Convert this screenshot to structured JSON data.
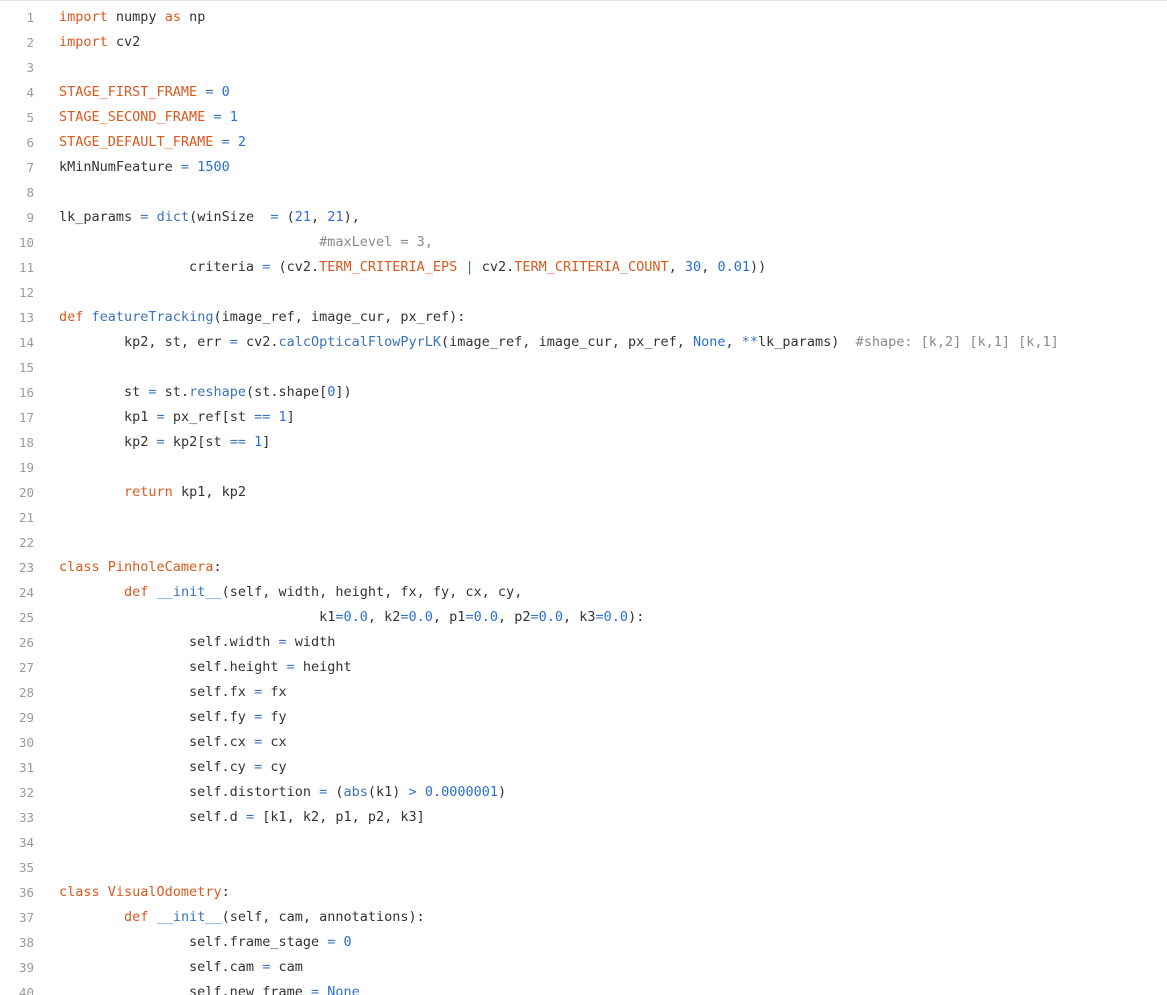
{
  "editor": {
    "language": "python",
    "colors": {
      "keyword": "#d9591f",
      "function": "#3b73bf",
      "number": "#2a6fd6",
      "comment": "#8a8a8a",
      "text": "#333333",
      "line_number": "#9a9a9a"
    },
    "lines": [
      {
        "n": "1",
        "tokens": [
          [
            "kw",
            "import"
          ],
          [
            "plain",
            " numpy "
          ],
          [
            "kw",
            "as"
          ],
          [
            "plain",
            " np"
          ]
        ]
      },
      {
        "n": "2",
        "tokens": [
          [
            "kw",
            "import"
          ],
          [
            "plain",
            " cv2"
          ]
        ]
      },
      {
        "n": "3",
        "tokens": []
      },
      {
        "n": "4",
        "tokens": [
          [
            "const",
            "STAGE_FIRST_FRAME"
          ],
          [
            "plain",
            " "
          ],
          [
            "op",
            "="
          ],
          [
            "plain",
            " "
          ],
          [
            "num",
            "0"
          ]
        ]
      },
      {
        "n": "5",
        "tokens": [
          [
            "const",
            "STAGE_SECOND_FRAME"
          ],
          [
            "plain",
            " "
          ],
          [
            "op",
            "="
          ],
          [
            "plain",
            " "
          ],
          [
            "num",
            "1"
          ]
        ]
      },
      {
        "n": "6",
        "tokens": [
          [
            "const",
            "STAGE_DEFAULT_FRAME"
          ],
          [
            "plain",
            " "
          ],
          [
            "op",
            "="
          ],
          [
            "plain",
            " "
          ],
          [
            "num",
            "2"
          ]
        ]
      },
      {
        "n": "7",
        "tokens": [
          [
            "plain",
            "kMinNumFeature "
          ],
          [
            "op",
            "="
          ],
          [
            "plain",
            " "
          ],
          [
            "num",
            "1500"
          ]
        ]
      },
      {
        "n": "8",
        "tokens": []
      },
      {
        "n": "9",
        "tokens": [
          [
            "plain",
            "lk_params "
          ],
          [
            "op",
            "="
          ],
          [
            "plain",
            " "
          ],
          [
            "fn",
            "dict"
          ],
          [
            "plain",
            "(winSize  "
          ],
          [
            "op",
            "="
          ],
          [
            "plain",
            " ("
          ],
          [
            "num",
            "21"
          ],
          [
            "plain",
            ", "
          ],
          [
            "num",
            "21"
          ],
          [
            "plain",
            "),"
          ]
        ]
      },
      {
        "n": "10",
        "tokens": [
          [
            "plain",
            "                                "
          ],
          [
            "cmt",
            "#maxLevel = 3,"
          ]
        ]
      },
      {
        "n": "11",
        "tokens": [
          [
            "plain",
            "                criteria "
          ],
          [
            "op",
            "="
          ],
          [
            "plain",
            " (cv2."
          ],
          [
            "const",
            "TERM_CRITERIA_EPS"
          ],
          [
            "plain",
            " "
          ],
          [
            "op",
            "|"
          ],
          [
            "plain",
            " cv2."
          ],
          [
            "const",
            "TERM_CRITERIA_COUNT"
          ],
          [
            "plain",
            ", "
          ],
          [
            "num",
            "30"
          ],
          [
            "plain",
            ", "
          ],
          [
            "num",
            "0.01"
          ],
          [
            "plain",
            "))"
          ]
        ]
      },
      {
        "n": "12",
        "tokens": []
      },
      {
        "n": "13",
        "tokens": [
          [
            "kw",
            "def"
          ],
          [
            "plain",
            " "
          ],
          [
            "fn",
            "featureTracking"
          ],
          [
            "plain",
            "(image_ref, image_cur, px_ref):"
          ]
        ]
      },
      {
        "n": "14",
        "tokens": [
          [
            "plain",
            "        kp2, st, err "
          ],
          [
            "op",
            "="
          ],
          [
            "plain",
            " cv2."
          ],
          [
            "fn",
            "calcOpticalFlowPyrLK"
          ],
          [
            "plain",
            "(image_ref, image_cur, px_ref, "
          ],
          [
            "num",
            "None"
          ],
          [
            "plain",
            ", "
          ],
          [
            "op",
            "**"
          ],
          [
            "plain",
            "lk_params)  "
          ],
          [
            "cmt",
            "#shape: [k,2] [k,1] [k,1]"
          ]
        ]
      },
      {
        "n": "15",
        "tokens": []
      },
      {
        "n": "16",
        "tokens": [
          [
            "plain",
            "        st "
          ],
          [
            "op",
            "="
          ],
          [
            "plain",
            " st."
          ],
          [
            "fn",
            "reshape"
          ],
          [
            "plain",
            "(st.shape["
          ],
          [
            "num",
            "0"
          ],
          [
            "plain",
            "])"
          ]
        ]
      },
      {
        "n": "17",
        "tokens": [
          [
            "plain",
            "        kp1 "
          ],
          [
            "op",
            "="
          ],
          [
            "plain",
            " px_ref[st "
          ],
          [
            "op",
            "=="
          ],
          [
            "plain",
            " "
          ],
          [
            "num",
            "1"
          ],
          [
            "plain",
            "]"
          ]
        ]
      },
      {
        "n": "18",
        "tokens": [
          [
            "plain",
            "        kp2 "
          ],
          [
            "op",
            "="
          ],
          [
            "plain",
            " kp2[st "
          ],
          [
            "op",
            "=="
          ],
          [
            "plain",
            " "
          ],
          [
            "num",
            "1"
          ],
          [
            "plain",
            "]"
          ]
        ]
      },
      {
        "n": "19",
        "tokens": []
      },
      {
        "n": "20",
        "tokens": [
          [
            "plain",
            "        "
          ],
          [
            "kw",
            "return"
          ],
          [
            "plain",
            " kp1, kp2"
          ]
        ]
      },
      {
        "n": "21",
        "tokens": []
      },
      {
        "n": "22",
        "tokens": []
      },
      {
        "n": "23",
        "tokens": [
          [
            "kw",
            "class"
          ],
          [
            "plain",
            " "
          ],
          [
            "cls",
            "PinholeCamera"
          ],
          [
            "plain",
            ":"
          ]
        ]
      },
      {
        "n": "24",
        "tokens": [
          [
            "plain",
            "        "
          ],
          [
            "kw",
            "def"
          ],
          [
            "plain",
            " "
          ],
          [
            "fn",
            "__init__"
          ],
          [
            "plain",
            "(self, width, height, fx, fy, cx, cy,"
          ]
        ]
      },
      {
        "n": "25",
        "tokens": [
          [
            "plain",
            "                                k1"
          ],
          [
            "op",
            "="
          ],
          [
            "num",
            "0.0"
          ],
          [
            "plain",
            ", k2"
          ],
          [
            "op",
            "="
          ],
          [
            "num",
            "0.0"
          ],
          [
            "plain",
            ", p1"
          ],
          [
            "op",
            "="
          ],
          [
            "num",
            "0.0"
          ],
          [
            "plain",
            ", p2"
          ],
          [
            "op",
            "="
          ],
          [
            "num",
            "0.0"
          ],
          [
            "plain",
            ", k3"
          ],
          [
            "op",
            "="
          ],
          [
            "num",
            "0.0"
          ],
          [
            "plain",
            "):"
          ]
        ]
      },
      {
        "n": "26",
        "tokens": [
          [
            "plain",
            "                self.width "
          ],
          [
            "op",
            "="
          ],
          [
            "plain",
            " width"
          ]
        ]
      },
      {
        "n": "27",
        "tokens": [
          [
            "plain",
            "                self.height "
          ],
          [
            "op",
            "="
          ],
          [
            "plain",
            " height"
          ]
        ]
      },
      {
        "n": "28",
        "tokens": [
          [
            "plain",
            "                self.fx "
          ],
          [
            "op",
            "="
          ],
          [
            "plain",
            " fx"
          ]
        ]
      },
      {
        "n": "29",
        "tokens": [
          [
            "plain",
            "                self.fy "
          ],
          [
            "op",
            "="
          ],
          [
            "plain",
            " fy"
          ]
        ]
      },
      {
        "n": "30",
        "tokens": [
          [
            "plain",
            "                self.cx "
          ],
          [
            "op",
            "="
          ],
          [
            "plain",
            " cx"
          ]
        ]
      },
      {
        "n": "31",
        "tokens": [
          [
            "plain",
            "                self.cy "
          ],
          [
            "op",
            "="
          ],
          [
            "plain",
            " cy"
          ]
        ]
      },
      {
        "n": "32",
        "tokens": [
          [
            "plain",
            "                self.distortion "
          ],
          [
            "op",
            "="
          ],
          [
            "plain",
            " ("
          ],
          [
            "fn",
            "abs"
          ],
          [
            "plain",
            "(k1) "
          ],
          [
            "op",
            ">"
          ],
          [
            "plain",
            " "
          ],
          [
            "num",
            "0.0000001"
          ],
          [
            "plain",
            ")"
          ]
        ]
      },
      {
        "n": "33",
        "tokens": [
          [
            "plain",
            "                self.d "
          ],
          [
            "op",
            "="
          ],
          [
            "plain",
            " [k1, k2, p1, p2, k3]"
          ]
        ]
      },
      {
        "n": "34",
        "tokens": []
      },
      {
        "n": "35",
        "tokens": []
      },
      {
        "n": "36",
        "tokens": [
          [
            "kw",
            "class"
          ],
          [
            "plain",
            " "
          ],
          [
            "cls",
            "VisualOdometry"
          ],
          [
            "plain",
            ":"
          ]
        ]
      },
      {
        "n": "37",
        "tokens": [
          [
            "plain",
            "        "
          ],
          [
            "kw",
            "def"
          ],
          [
            "plain",
            " "
          ],
          [
            "fn",
            "__init__"
          ],
          [
            "plain",
            "(self, cam, annotations):"
          ]
        ]
      },
      {
        "n": "38",
        "tokens": [
          [
            "plain",
            "                self.frame_stage "
          ],
          [
            "op",
            "="
          ],
          [
            "plain",
            " "
          ],
          [
            "num",
            "0"
          ]
        ]
      },
      {
        "n": "39",
        "tokens": [
          [
            "plain",
            "                self.cam "
          ],
          [
            "op",
            "="
          ],
          [
            "plain",
            " cam"
          ]
        ]
      },
      {
        "n": "40",
        "tokens": [
          [
            "plain",
            "                self.new_frame "
          ],
          [
            "op",
            "="
          ],
          [
            "plain",
            " "
          ],
          [
            "num",
            "None"
          ]
        ]
      }
    ]
  }
}
